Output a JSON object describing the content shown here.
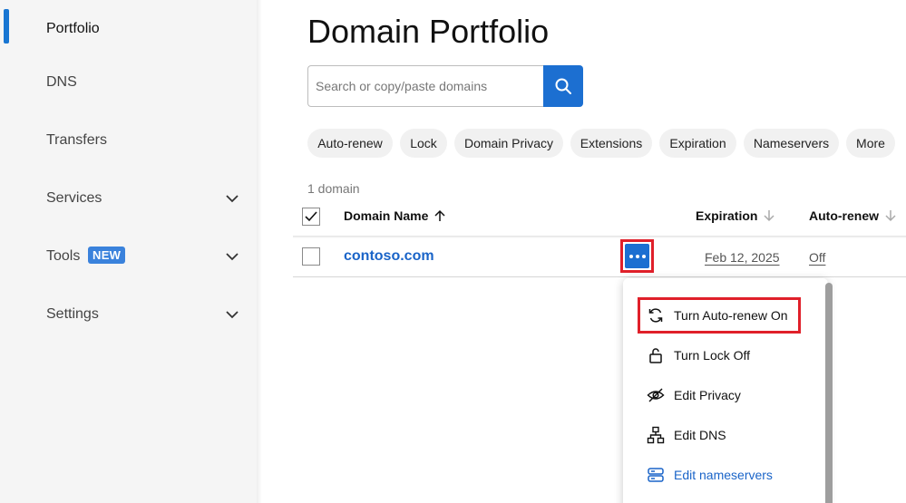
{
  "sidebar": {
    "items": [
      {
        "label": "Portfolio"
      },
      {
        "label": "DNS"
      },
      {
        "label": "Transfers"
      },
      {
        "label": "Services"
      },
      {
        "label": "Tools",
        "badge": "NEW"
      },
      {
        "label": "Settings"
      }
    ]
  },
  "main": {
    "title": "Domain Portfolio",
    "search": {
      "placeholder": "Search or copy/paste domains",
      "value": ""
    },
    "filters": [
      "Auto-renew",
      "Lock",
      "Domain Privacy",
      "Extensions",
      "Expiration",
      "Nameservers",
      "More"
    ],
    "domain_count": "1 domain",
    "table": {
      "columns": [
        "Domain Name",
        "Expiration",
        "Auto-renew"
      ],
      "rows": [
        {
          "domain": "contoso.com",
          "expiration": "Feb 12, 2025",
          "auto_renew": "Off"
        }
      ]
    },
    "menu": {
      "items": [
        {
          "label": "Turn Auto-renew On",
          "icon": "refresh-icon"
        },
        {
          "label": "Turn Lock Off",
          "icon": "unlock-icon"
        },
        {
          "label": "Edit Privacy",
          "icon": "eye-off-icon"
        },
        {
          "label": "Edit DNS",
          "icon": "sitemap-icon"
        },
        {
          "label": "Edit nameservers",
          "icon": "server-icon"
        }
      ]
    }
  },
  "colors": {
    "accent": "#1c6fd1",
    "highlight": "#e0202a",
    "link": "#1a64c8"
  }
}
